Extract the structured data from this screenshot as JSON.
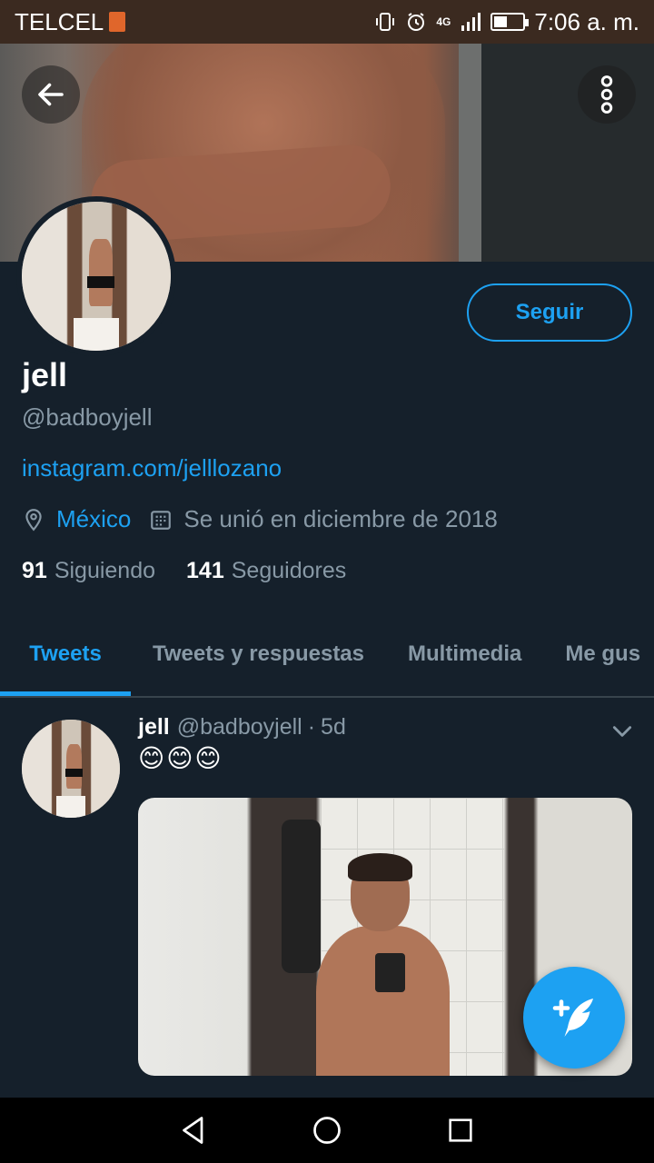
{
  "status_bar": {
    "carrier": "TELCEL",
    "network": "4G",
    "time": "7:06 a. m.",
    "battery_level": 0.45
  },
  "colors": {
    "accent": "#1da1f2",
    "background": "#15202b",
    "muted_text": "#8899a6",
    "divider": "#38444d"
  },
  "header": {
    "back_icon": "arrow-left-icon",
    "more_icon": "more-vertical-icon"
  },
  "profile": {
    "name": "jell",
    "handle": "@badboyjell",
    "link": "instagram.com/jelllozano",
    "location": "México",
    "joined": "Se unió en diciembre de 2018",
    "follow_label": "Seguir",
    "following_count": "91",
    "following_label": "Siguiendo",
    "followers_count": "141",
    "followers_label": "Seguidores"
  },
  "tabs": [
    {
      "label": "Tweets",
      "active": true
    },
    {
      "label": "Tweets y respuestas",
      "active": false
    },
    {
      "label": "Multimedia",
      "active": false
    },
    {
      "label": "Me gus",
      "active": false
    }
  ],
  "tweet": {
    "name": "jell",
    "handle": "@badboyjell",
    "separator": "·",
    "time": "5d",
    "text": "😊😊😊"
  },
  "fab": {
    "icon": "compose-tweet-icon"
  },
  "nav_bar": {
    "back_icon": "nav-back-icon",
    "home_icon": "nav-home-icon",
    "recents_icon": "nav-recents-icon"
  }
}
